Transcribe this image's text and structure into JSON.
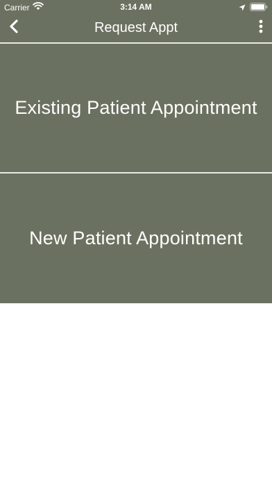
{
  "status_bar": {
    "carrier": "Carrier",
    "time": "3:14 AM"
  },
  "nav": {
    "title": "Request Appt"
  },
  "panels": [
    {
      "label": "Existing Patient Appointment"
    },
    {
      "label": "New Patient Appointment"
    }
  ],
  "colors": {
    "primary": "#6b7160",
    "divider": "#e9ebe5",
    "text": "#ffffff",
    "background": "#ffffff"
  },
  "icons": {
    "wifi": "wifi-icon",
    "location": "location-arrow-icon",
    "battery": "battery-icon",
    "back": "chevron-left-icon",
    "more": "more-vertical-icon"
  }
}
